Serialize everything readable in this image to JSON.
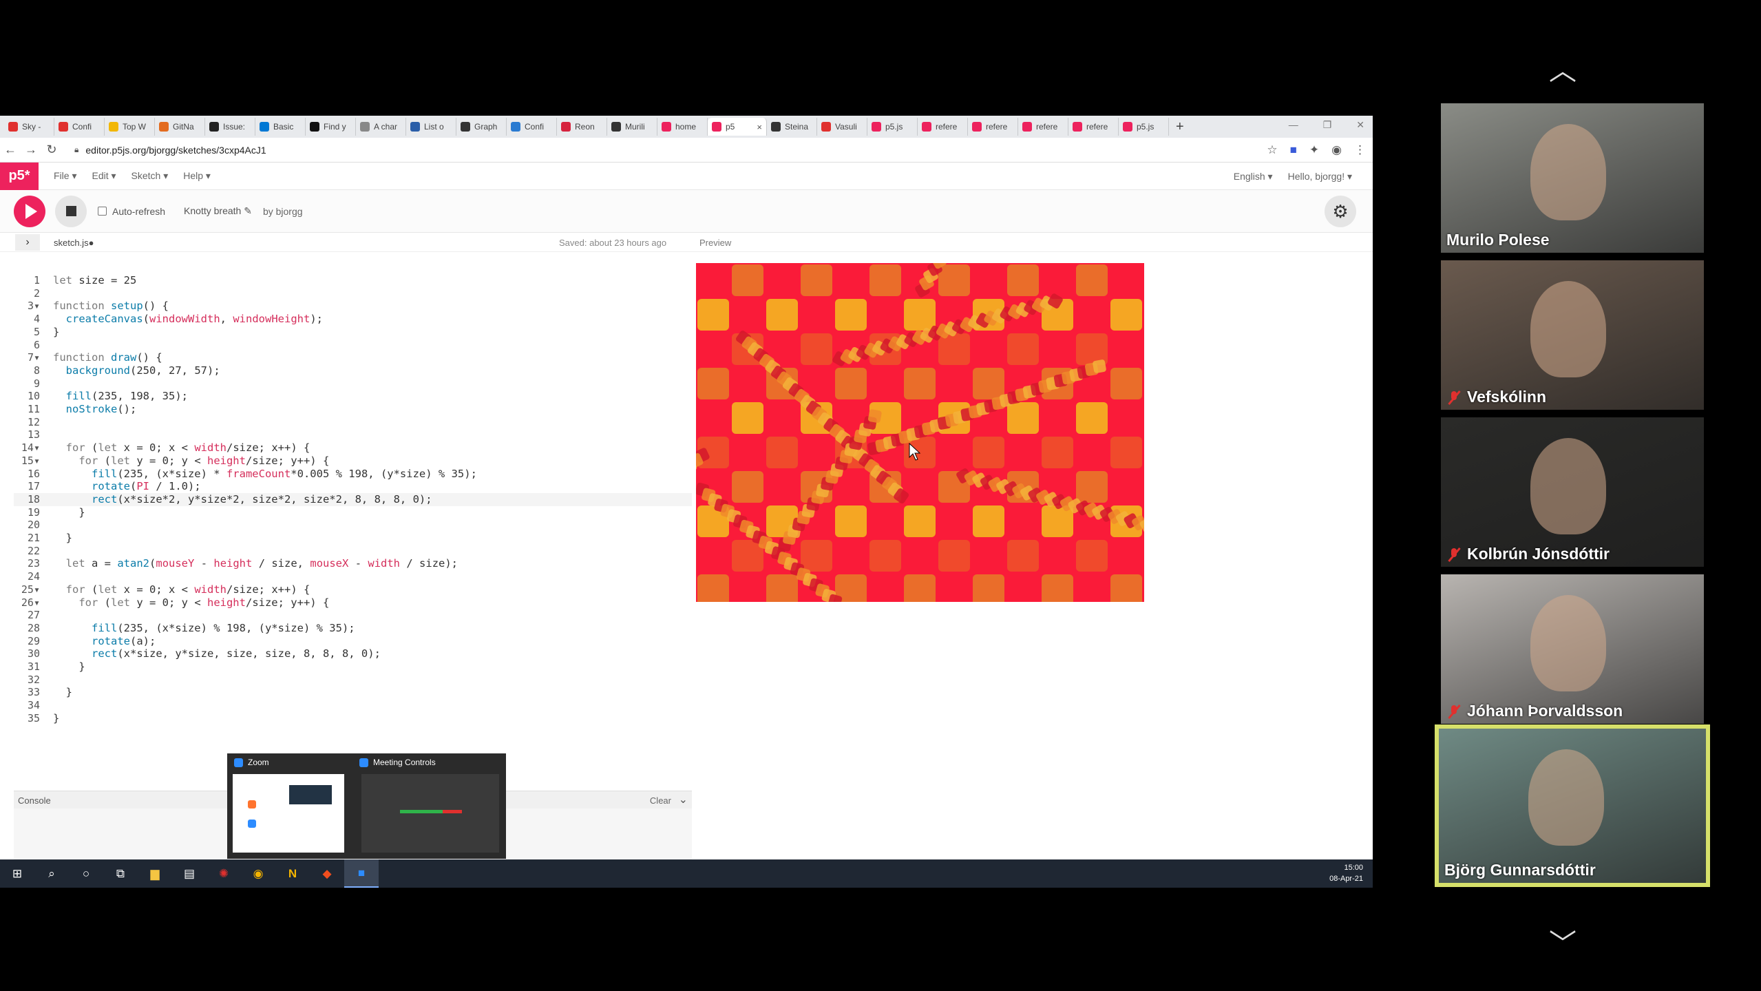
{
  "browser": {
    "tabs": [
      {
        "label": "Sky -",
        "color": "#e0302e"
      },
      {
        "label": "Confi",
        "color": "#e0302e"
      },
      {
        "label": "Top W",
        "color": "#f2b705"
      },
      {
        "label": "GitNa",
        "color": "#e36b1f"
      },
      {
        "label": "Issue:",
        "color": "#222222"
      },
      {
        "label": "Basic",
        "color": "#0078d4"
      },
      {
        "label": "Find y",
        "color": "#111111"
      },
      {
        "label": "A char",
        "color": "#888888"
      },
      {
        "label": "List o",
        "color": "#2a5ea8"
      },
      {
        "label": "Graph",
        "color": "#333333"
      },
      {
        "label": "Confi",
        "color": "#2a7bd1"
      },
      {
        "label": "Reon",
        "color": "#d6233e"
      },
      {
        "label": "Murili",
        "color": "#333333"
      },
      {
        "label": "home",
        "color": "#ed225d"
      },
      {
        "label": "p5",
        "color": "#ed225d"
      },
      {
        "label": "Steina",
        "color": "#333333"
      },
      {
        "label": "Vasuli",
        "color": "#e0302e"
      },
      {
        "label": "p5.js",
        "color": "#ed225d"
      },
      {
        "label": "refere",
        "color": "#ed225d"
      },
      {
        "label": "refere",
        "color": "#ed225d"
      },
      {
        "label": "refere",
        "color": "#ed225d"
      },
      {
        "label": "refere",
        "color": "#ed225d"
      },
      {
        "label": "p5.js",
        "color": "#ed225d"
      }
    ],
    "url": "editor.p5js.org/bjorgg/sketches/3cxp4AcJ1"
  },
  "p5": {
    "logo": "p5*",
    "menu": [
      "File ▾",
      "Edit ▾",
      "Sketch ▾",
      "Help ▾"
    ],
    "language": "English ▾",
    "greeting": "Hello, bjorgg! ▾",
    "auto_refresh": "Auto-refresh",
    "sketch_name": "Knotty breath ✎",
    "sketch_owner": "by bjorgg",
    "file_name": "sketch.js●",
    "saved_status": "Saved: about 23 hours ago",
    "preview_label": "Preview",
    "console_label": "Console",
    "console_clear": "Clear"
  },
  "code_lines": [
    {
      "n": "1",
      "t": "let size = 25"
    },
    {
      "n": "2",
      "t": ""
    },
    {
      "n": "3▾",
      "t": "function setup() {"
    },
    {
      "n": "4",
      "t": "  createCanvas(windowWidth, windowHeight);"
    },
    {
      "n": "5",
      "t": "}"
    },
    {
      "n": "6",
      "t": ""
    },
    {
      "n": "7▾",
      "t": "function draw() {"
    },
    {
      "n": "8",
      "t": "  background(250, 27, 57);"
    },
    {
      "n": "9",
      "t": ""
    },
    {
      "n": "10",
      "t": "  fill(235, 198, 35);"
    },
    {
      "n": "11",
      "t": "  noStroke();"
    },
    {
      "n": "12",
      "t": ""
    },
    {
      "n": "13",
      "t": ""
    },
    {
      "n": "14▾",
      "t": "  for (let x = 0; x < width/size; x++) {"
    },
    {
      "n": "15▾",
      "t": "    for (let y = 0; y < height/size; y++) {"
    },
    {
      "n": "16",
      "t": "      fill(235, (x*size) * frameCount*0.005 % 198, (y*size) % 35);"
    },
    {
      "n": "17",
      "t": "      rotate(PI / 1.0);"
    },
    {
      "n": "18",
      "t": "      rect(x*size*2, y*size*2, size*2, size*2, 8, 8, 8, 0);"
    },
    {
      "n": "19",
      "t": "    }"
    },
    {
      "n": "20",
      "t": ""
    },
    {
      "n": "21",
      "t": "  }"
    },
    {
      "n": "22",
      "t": ""
    },
    {
      "n": "23",
      "t": "  let a = atan2(mouseY - height / size, mouseX - width / size);"
    },
    {
      "n": "24",
      "t": ""
    },
    {
      "n": "25▾",
      "t": "  for (let x = 0; x < width/size; x++) {"
    },
    {
      "n": "26▾",
      "t": "    for (let y = 0; y < height/size; y++) {"
    },
    {
      "n": "27",
      "t": ""
    },
    {
      "n": "28",
      "t": "      fill(235, (x*size) % 198, (y*size) % 35);"
    },
    {
      "n": "29",
      "t": "      rotate(a);"
    },
    {
      "n": "30",
      "t": "      rect(x*size, y*size, size, size, 8, 8, 8, 0);"
    },
    {
      "n": "31",
      "t": "    }"
    },
    {
      "n": "32",
      "t": ""
    },
    {
      "n": "33",
      "t": "  }"
    },
    {
      "n": "34",
      "t": ""
    },
    {
      "n": "35",
      "t": "}"
    }
  ],
  "highlighted_line": 18,
  "preview_colors": {
    "background": "#fa1b39",
    "tile_a": "#ea6d2a",
    "tile_b": "#f5a623",
    "tile_c": "#f04a2c"
  },
  "zoom_popup": {
    "left_title": "Zoom",
    "right_title": "Meeting Controls"
  },
  "taskbar": {
    "time": "15:00",
    "date": "08-Apr-21"
  },
  "participants": [
    {
      "name": "Murilo Polese",
      "muted": false,
      "active": false,
      "bg": "#8a8c86"
    },
    {
      "name": "Vefskólinn",
      "muted": true,
      "active": false,
      "bg": "#6a5a4e"
    },
    {
      "name": "Kolbrún Jónsdóttir",
      "muted": true,
      "active": false,
      "bg": "#2a2a28"
    },
    {
      "name": "Jóhann Þorvaldsson",
      "muted": true,
      "active": false,
      "bg": "#b8b4b0"
    },
    {
      "name": "Björg Gunnarsdóttir",
      "muted": false,
      "active": true,
      "bg": "#6f8a84"
    }
  ]
}
